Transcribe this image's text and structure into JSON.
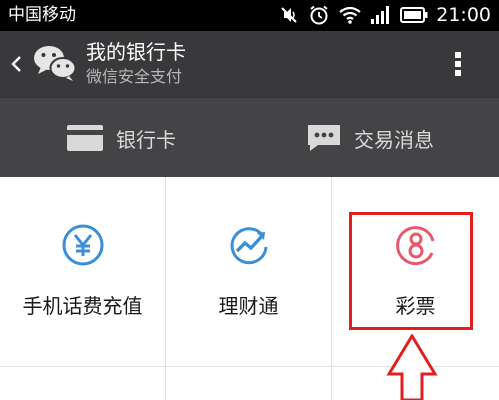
{
  "status_bar": {
    "carrier": "中国移动",
    "time": "21:00",
    "icons": [
      "mute-icon",
      "alarm-icon",
      "wifi-icon",
      "signal-icon",
      "battery-icon"
    ]
  },
  "app_bar": {
    "title": "我的银行卡",
    "subtitle": "微信安全支付",
    "icons": [
      "back-icon",
      "wechat-logo-icon",
      "more-icon"
    ]
  },
  "tabs": [
    {
      "label": "银行卡",
      "icon": "card-icon"
    },
    {
      "label": "交易消息",
      "icon": "message-icon"
    }
  ],
  "services": [
    {
      "label": "手机话费充值",
      "icon": "yen-icon",
      "color": "#3b8ed8"
    },
    {
      "label": "理财通",
      "icon": "trend-icon",
      "color": "#3b8ed8"
    },
    {
      "label": "彩票",
      "icon": "lottery-icon",
      "color": "#e8576a"
    }
  ],
  "annotation": {
    "color": "#e02020"
  }
}
